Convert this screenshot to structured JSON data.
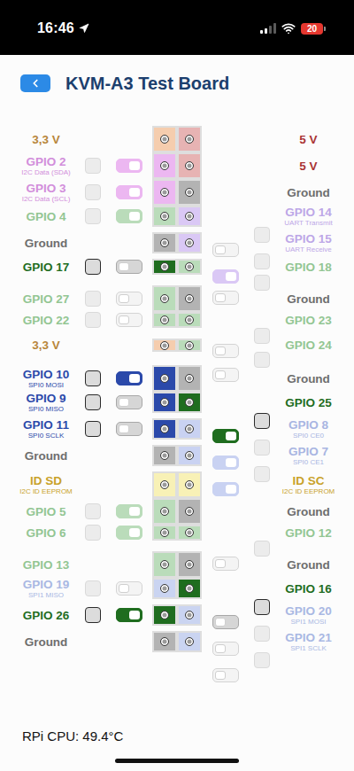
{
  "status_bar": {
    "time": "16:46",
    "battery": "20",
    "battery_low": true,
    "signal": 0.5
  },
  "title": "KVM-A3 Test Board",
  "rows": [
    {
      "left": {
        "label": "3,3 V",
        "color": "#f5cdae",
        "label_color": "#b8863b",
        "active": false,
        "controls": null
      },
      "right": {
        "label": "5 V",
        "color": "#e7b3b3",
        "label_color": "#a93434",
        "active": false,
        "controls": null
      }
    },
    {
      "left": {
        "label": "GPIO 2",
        "sub": "I2C Data (SDA)",
        "color": "#ecb7f1",
        "label_color": "#d28edb",
        "active": false,
        "controls": {
          "checked": false,
          "on": true
        }
      },
      "right": {
        "label": "5 V",
        "color": "#e7b3b3",
        "label_color": "#a93434",
        "active": false,
        "controls": null
      }
    },
    {
      "left": {
        "label": "GPIO 3",
        "sub": "I2C Data (SCL)",
        "color": "#ecb7f1",
        "label_color": "#d28edb",
        "active": false,
        "controls": {
          "checked": false,
          "on": true
        }
      },
      "right": {
        "label": "Ground",
        "color": "#b3b3b3",
        "label_color": "#6e6e6e",
        "active": false,
        "controls": null
      }
    },
    {
      "left": {
        "label": "GPIO 4",
        "color": "#badcba",
        "label_color": "#93c693",
        "active": false,
        "controls": {
          "checked": false,
          "on": true
        }
      },
      "right": {
        "label": "GPIO 14",
        "sub": "UART Transmit",
        "color": "#dac8f5",
        "label_color": "#bda7e7",
        "active": false,
        "controls": {
          "checked": false,
          "on": false
        }
      }
    },
    {
      "left": {
        "label": "Ground",
        "color": "#b3b3b3",
        "label_color": "#6e6e6e",
        "active": false,
        "controls": null
      },
      "right": {
        "label": "GPIO 15",
        "sub": "UART Receive",
        "color": "#dac8f5",
        "label_color": "#bda7e7",
        "active": false,
        "controls": {
          "checked": false,
          "on": true
        }
      }
    },
    {
      "left": {
        "label": "GPIO 17",
        "color": "#1f6d1f",
        "label_color": "#1f6d1f",
        "active": true,
        "controls": {
          "checked": false,
          "on": false
        }
      },
      "right": {
        "label": "GPIO 18",
        "color": "#badcba",
        "label_color": "#93c693",
        "active": false,
        "controls": {
          "checked": false,
          "on": false
        }
      }
    },
    {
      "left": {
        "label": "GPIO 27",
        "color": "#badcba",
        "label_color": "#93c693",
        "active": false,
        "controls": {
          "checked": false,
          "on": false
        }
      },
      "right": {
        "label": "Ground",
        "color": "#b3b3b3",
        "label_color": "#6e6e6e",
        "active": false,
        "controls": null
      }
    },
    {
      "left": {
        "label": "GPIO 22",
        "color": "#badcba",
        "label_color": "#93c693",
        "active": false,
        "controls": {
          "checked": false,
          "on": false
        }
      },
      "right": {
        "label": "GPIO 23",
        "color": "#badcba",
        "label_color": "#93c693",
        "active": false,
        "controls": {
          "checked": false,
          "on": false
        }
      }
    },
    {
      "left": {
        "label": "3,3 V",
        "color": "#f5cdae",
        "label_color": "#b8863b",
        "active": false,
        "controls": null
      },
      "right": {
        "label": "GPIO 24",
        "color": "#badcba",
        "label_color": "#93c693",
        "active": false,
        "controls": {
          "checked": false,
          "on": false
        }
      }
    },
    {
      "left": {
        "label": "GPIO 10",
        "sub": "SPI0 MOSI",
        "color": "#2b49aa",
        "label_color": "#2b49aa",
        "active": true,
        "controls": {
          "checked": false,
          "on": true
        }
      },
      "right": {
        "label": "Ground",
        "color": "#b3b3b3",
        "label_color": "#6e6e6e",
        "active": false,
        "controls": null
      }
    },
    {
      "left": {
        "label": "GPIO 9",
        "sub": "SPI0 MISO",
        "color": "#2b49aa",
        "label_color": "#2b49aa",
        "active": true,
        "controls": {
          "checked": false,
          "on": false
        }
      },
      "right": {
        "label": "GPIO 25",
        "color": "#1f6d1f",
        "label_color": "#1f6d1f",
        "active": true,
        "controls": {
          "checked": false,
          "on": true
        }
      }
    },
    {
      "left": {
        "label": "GPIO 11",
        "sub": "SPI0 SCLK",
        "color": "#2b49aa",
        "label_color": "#2b49aa",
        "active": true,
        "controls": {
          "checked": false,
          "on": false
        }
      },
      "right": {
        "label": "GPIO 8",
        "sub": "SPI0 CE0",
        "color": "#c9d2f2",
        "label_color": "#a8b5e2",
        "active": false,
        "controls": {
          "checked": false,
          "on": true
        }
      }
    },
    {
      "left": {
        "label": "Ground",
        "color": "#b3b3b3",
        "label_color": "#6e6e6e",
        "active": false,
        "controls": null
      },
      "right": {
        "label": "GPIO 7",
        "sub": "SPI0 CE1",
        "color": "#c9d2f2",
        "label_color": "#a8b5e2",
        "active": false,
        "controls": {
          "checked": false,
          "on": true
        }
      }
    },
    {
      "left": {
        "label": "ID SD",
        "sub": "I2C ID EEPROM",
        "color": "#f8f1b6",
        "label_color": "#c9a22a",
        "active": false,
        "controls": null
      },
      "right": {
        "label": "ID SC",
        "sub": "I2C ID EEPROM",
        "color": "#f8f1b6",
        "label_color": "#c9a22a",
        "active": false,
        "controls": null
      }
    },
    {
      "left": {
        "label": "GPIO 5",
        "color": "#badcba",
        "label_color": "#93c693",
        "active": false,
        "controls": {
          "checked": false,
          "on": true
        }
      },
      "right": {
        "label": "Ground",
        "color": "#b3b3b3",
        "label_color": "#6e6e6e",
        "active": false,
        "controls": null
      }
    },
    {
      "left": {
        "label": "GPIO 6",
        "color": "#badcba",
        "label_color": "#93c693",
        "active": false,
        "controls": {
          "checked": false,
          "on": true
        }
      },
      "right": {
        "label": "GPIO 12",
        "color": "#badcba",
        "label_color": "#93c693",
        "active": false,
        "controls": {
          "checked": false,
          "on": false
        }
      }
    },
    {
      "left": {
        "label": "GPIO 13",
        "color": "#badcba",
        "label_color": "#93c693",
        "active": false,
        "controls": null
      },
      "right": {
        "label": "Ground",
        "color": "#b3b3b3",
        "label_color": "#6e6e6e",
        "active": false,
        "controls": null
      }
    },
    {
      "left": {
        "label": "GPIO 19",
        "sub": "SPI1 MISO",
        "color": "#cad4f1",
        "label_color": "#a9b8e3",
        "active": false,
        "controls": {
          "checked": false,
          "on": false
        }
      },
      "right": {
        "label": "GPIO 16",
        "color": "#1f6d1f",
        "label_color": "#1f6d1f",
        "active": true,
        "controls": {
          "checked": false,
          "on": false
        }
      }
    },
    {
      "left": {
        "label": "GPIO 26",
        "color": "#1f6d1f",
        "label_color": "#1f6d1f",
        "active": true,
        "controls": {
          "checked": false,
          "on": true
        }
      },
      "right": {
        "label": "GPIO 20",
        "sub": "SPI1 MOSI",
        "color": "#cad4f1",
        "label_color": "#a9b8e3",
        "active": false,
        "controls": {
          "checked": false,
          "on": false
        }
      }
    },
    {
      "left": {
        "label": "Ground",
        "color": "#b3b3b3",
        "label_color": "#6e6e6e",
        "active": false,
        "controls": null
      },
      "right": {
        "label": "GPIO 21",
        "sub": "SPI1 SCLK",
        "color": "#cad4f1",
        "label_color": "#a9b8e3",
        "active": false,
        "controls": {
          "checked": false,
          "on": false
        }
      }
    }
  ],
  "footer": "RPi CPU: 49.4°C"
}
